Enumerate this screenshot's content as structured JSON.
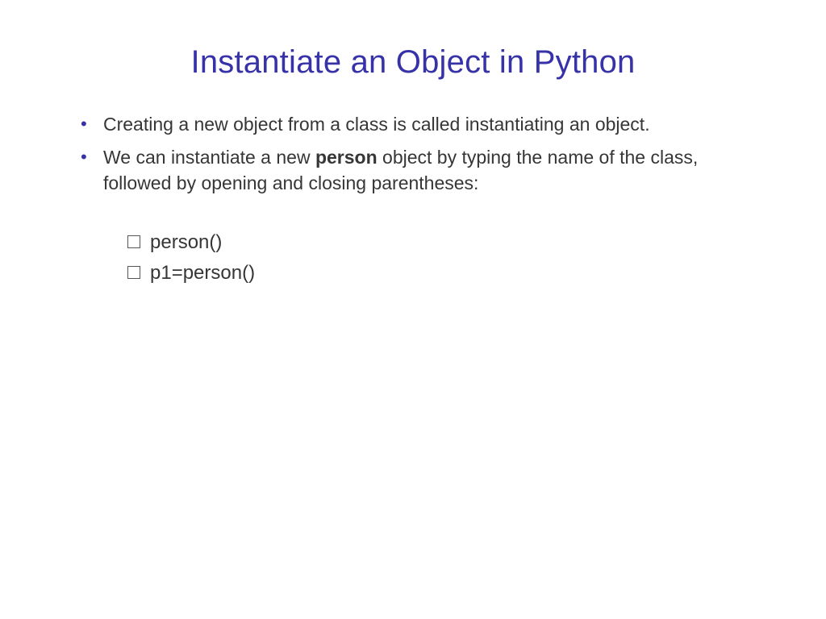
{
  "title": "Instantiate an Object in Python",
  "bullets": [
    {
      "parts": [
        {
          "text": "Creating a new object from a class is called instantiating an object.",
          "bold": false
        }
      ]
    },
    {
      "parts": [
        {
          "text": "We can instantiate a new ",
          "bold": false
        },
        {
          "text": "person",
          "bold": true
        },
        {
          "text": " object by typing the name of the class, followed by opening and closing parentheses:",
          "bold": false
        }
      ]
    }
  ],
  "sub_items": [
    "person()",
    "p1=person()"
  ]
}
